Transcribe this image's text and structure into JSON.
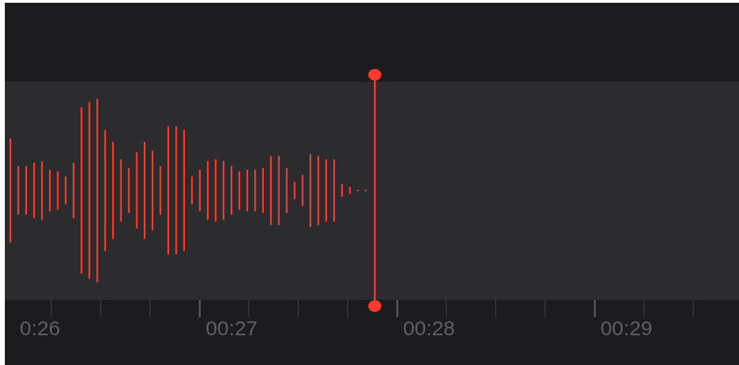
{
  "timeline": {
    "labels": [
      "0:26",
      "00:27",
      "00:28",
      "00:29"
    ]
  }
}
